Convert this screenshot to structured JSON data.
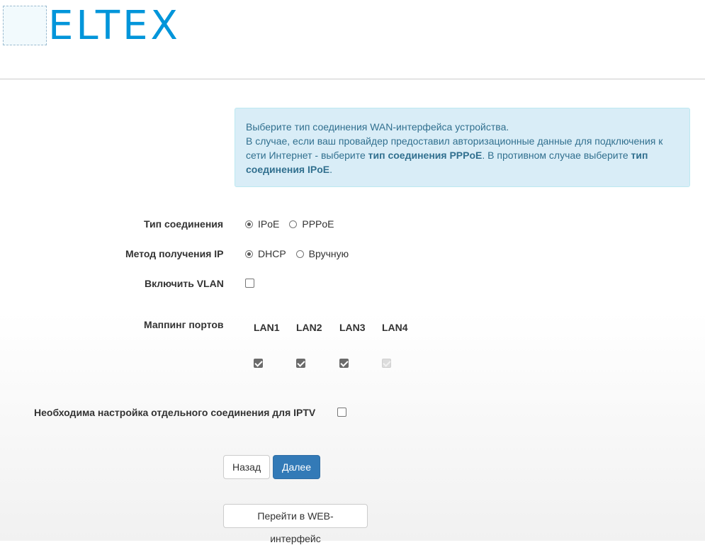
{
  "header": {
    "logo_text": "ELTEX",
    "logo_color": "#0095da"
  },
  "info": {
    "line1": "Выберите тип соединения WAN-интерфейса устройства.",
    "line2_a": "В случае, если ваш провайдер предоставил авторизационные данные для подключения к сети Интернет - выберите ",
    "line2_b": "тип соединения PPPoE",
    "line2_c": ". В противном случае выберите ",
    "line2_d": "тип соединения IPoE",
    "line2_e": "."
  },
  "form": {
    "connection_type": {
      "label": "Тип соединения",
      "options": [
        "IPoE",
        "PPPoE"
      ],
      "selected": "IPoE"
    },
    "ip_method": {
      "label": "Метод получения IP",
      "options": [
        "DHCP",
        "Вручную"
      ],
      "selected": "DHCP"
    },
    "vlan": {
      "label": "Включить VLAN",
      "checked": false
    },
    "port_mapping": {
      "label": "Маппинг портов",
      "ports": [
        {
          "name": "LAN1",
          "checked": true,
          "disabled": false
        },
        {
          "name": "LAN2",
          "checked": true,
          "disabled": false
        },
        {
          "name": "LAN3",
          "checked": true,
          "disabled": false
        },
        {
          "name": "LAN4",
          "checked": true,
          "disabled": true
        }
      ]
    },
    "iptv": {
      "label": "Необходима настройка отдельного соединения для IPTV",
      "checked": false
    }
  },
  "buttons": {
    "back": "Назад",
    "next": "Далее",
    "web": "Перейти в WEB-интерфейс"
  },
  "colors": {
    "primary": "#337ab7",
    "info_bg": "#d9edf7",
    "info_text": "#31708f"
  }
}
